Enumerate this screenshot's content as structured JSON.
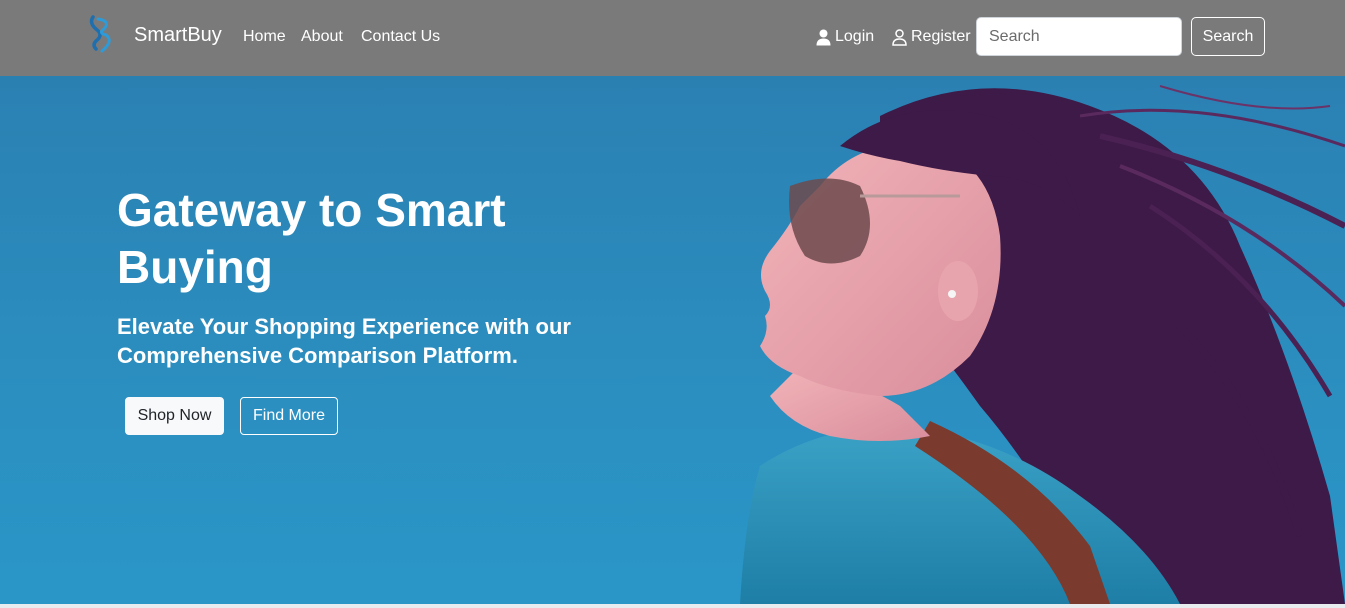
{
  "brand": {
    "name": "SmartBuy",
    "logo_icon": "smartbuy-logo-icon"
  },
  "nav": {
    "links": [
      {
        "label": "Home"
      },
      {
        "label": "About"
      },
      {
        "label": "Contact Us"
      }
    ],
    "login_label": "Login",
    "register_label": "Register",
    "search_placeholder": "Search",
    "search_button_label": "Search"
  },
  "hero": {
    "title": "Gateway to Smart Buying",
    "subtitle": "Elevate Your Shopping Experience with our Comprehensive Comparison Platform.",
    "primary_button": "Shop Now",
    "secondary_button": "Find More"
  },
  "colors": {
    "navbar": "#7a7a7a",
    "hero_background": "#2a86b8",
    "text_on_dark": "#ffffff"
  }
}
